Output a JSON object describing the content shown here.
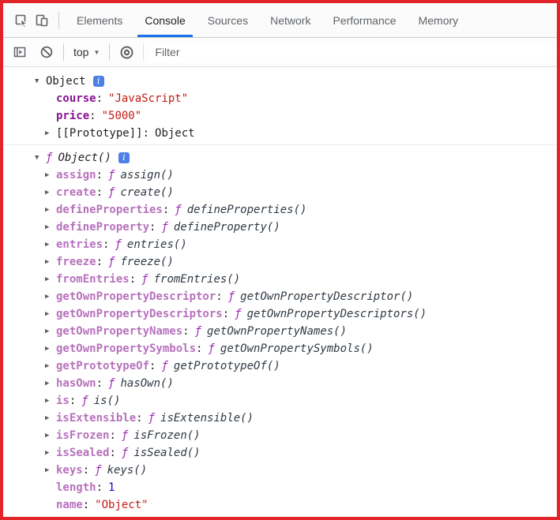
{
  "window": {
    "border_color": "#e0242a"
  },
  "tabbar": {
    "tabs": [
      {
        "label": "Elements",
        "active": false
      },
      {
        "label": "Console",
        "active": true
      },
      {
        "label": "Sources",
        "active": false
      },
      {
        "label": "Network",
        "active": false
      },
      {
        "label": "Performance",
        "active": false
      },
      {
        "label": "Memory",
        "active": false
      }
    ],
    "active_underline_color": "#1a73e8",
    "icons": [
      "inspect-element-icon",
      "device-toolbar-icon"
    ]
  },
  "console_toolbar": {
    "context_selector": "top",
    "filter_placeholder": "Filter",
    "icons": [
      "console-sidebar-icon",
      "clear-console-icon",
      "eye-icon"
    ]
  },
  "console": {
    "info_badge": "i",
    "colors": {
      "enumerable_name": "#881391",
      "non_enumerable_name": "#b771bd",
      "string_value": "#c41a16",
      "number_value": "#1c00cf",
      "function_symbol": "#9c27b0"
    },
    "entries": [
      {
        "header": {
          "text": "Object",
          "is_function": false,
          "has_info": true,
          "expanded": true
        },
        "children": [
          {
            "name": "course",
            "name_style": "enumerable",
            "expandable": false,
            "value": "\"JavaScript\"",
            "value_type": "string"
          },
          {
            "name": "price",
            "name_style": "enumerable",
            "expandable": false,
            "value": "\"5000\"",
            "value_type": "string"
          },
          {
            "name": "[[Prototype]]",
            "name_style": "internal",
            "expandable": true,
            "value": "Object",
            "value_type": "plain"
          }
        ]
      },
      {
        "header": {
          "text": "Object()",
          "is_function": true,
          "has_info": true,
          "expanded": true
        },
        "children": [
          {
            "name": "assign",
            "name_style": "non-enumerable",
            "expandable": true,
            "value": "assign()",
            "value_type": "function"
          },
          {
            "name": "create",
            "name_style": "non-enumerable",
            "expandable": true,
            "value": "create()",
            "value_type": "function"
          },
          {
            "name": "defineProperties",
            "name_style": "non-enumerable",
            "expandable": true,
            "value": "defineProperties()",
            "value_type": "function"
          },
          {
            "name": "defineProperty",
            "name_style": "non-enumerable",
            "expandable": true,
            "value": "defineProperty()",
            "value_type": "function"
          },
          {
            "name": "entries",
            "name_style": "non-enumerable",
            "expandable": true,
            "value": "entries()",
            "value_type": "function"
          },
          {
            "name": "freeze",
            "name_style": "non-enumerable",
            "expandable": true,
            "value": "freeze()",
            "value_type": "function"
          },
          {
            "name": "fromEntries",
            "name_style": "non-enumerable",
            "expandable": true,
            "value": "fromEntries()",
            "value_type": "function"
          },
          {
            "name": "getOwnPropertyDescriptor",
            "name_style": "non-enumerable",
            "expandable": true,
            "value": "getOwnPropertyDescriptor()",
            "value_type": "function"
          },
          {
            "name": "getOwnPropertyDescriptors",
            "name_style": "non-enumerable",
            "expandable": true,
            "value": "getOwnPropertyDescriptors()",
            "value_type": "function"
          },
          {
            "name": "getOwnPropertyNames",
            "name_style": "non-enumerable",
            "expandable": true,
            "value": "getOwnPropertyNames()",
            "value_type": "function"
          },
          {
            "name": "getOwnPropertySymbols",
            "name_style": "non-enumerable",
            "expandable": true,
            "value": "getOwnPropertySymbols()",
            "value_type": "function"
          },
          {
            "name": "getPrototypeOf",
            "name_style": "non-enumerable",
            "expandable": true,
            "value": "getPrototypeOf()",
            "value_type": "function"
          },
          {
            "name": "hasOwn",
            "name_style": "non-enumerable",
            "expandable": true,
            "value": "hasOwn()",
            "value_type": "function"
          },
          {
            "name": "is",
            "name_style": "non-enumerable",
            "expandable": true,
            "value": "is()",
            "value_type": "function"
          },
          {
            "name": "isExtensible",
            "name_style": "non-enumerable",
            "expandable": true,
            "value": "isExtensible()",
            "value_type": "function"
          },
          {
            "name": "isFrozen",
            "name_style": "non-enumerable",
            "expandable": true,
            "value": "isFrozen()",
            "value_type": "function"
          },
          {
            "name": "isSealed",
            "name_style": "non-enumerable",
            "expandable": true,
            "value": "isSealed()",
            "value_type": "function"
          },
          {
            "name": "keys",
            "name_style": "non-enumerable",
            "expandable": true,
            "value": "keys()",
            "value_type": "function"
          },
          {
            "name": "length",
            "name_style": "non-enumerable",
            "expandable": false,
            "value": "1",
            "value_type": "number"
          },
          {
            "name": "name",
            "name_style": "non-enumerable",
            "expandable": false,
            "value": "\"Object\"",
            "value_type": "string"
          }
        ]
      }
    ]
  }
}
